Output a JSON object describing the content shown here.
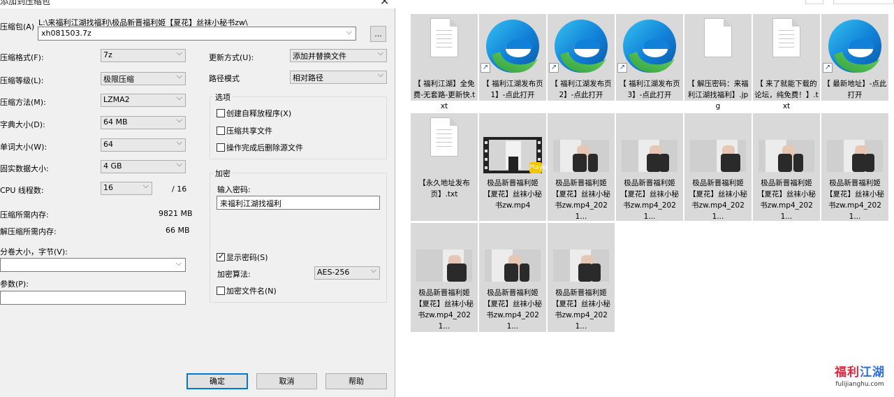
{
  "dialog": {
    "title": "添加到压缩包",
    "archive_label": "压缩包(A)",
    "archive_path": "L:\\来福利江湖找福利\\极品新晋福利姬【夏花】丝袜小秘书zw\\",
    "archive_name": "xh081503.7z",
    "browse_label": "...",
    "format_label": "压缩格式(F):",
    "format_value": "7z",
    "level_label": "压缩等级(L):",
    "level_value": "极限压缩",
    "method_label": "压缩方法(M):",
    "method_value": "LZMA2",
    "dict_label": "字典大小(D):",
    "dict_value": "64 MB",
    "word_label": "单词大小(W):",
    "word_value": "64",
    "solid_label": "固实数据大小:",
    "solid_value": "4 GB",
    "threads_label": "CPU 线程数:",
    "threads_value": "16",
    "threads_total": "/ 16",
    "mem_compress_label": "压缩所需内存:",
    "mem_compress_value": "9821 MB",
    "mem_decompress_label": "解压缩所需内存:",
    "mem_decompress_value": "66 MB",
    "volume_label": "分卷大小，字节(V):",
    "volume_value": "",
    "params_label": "参数(P):",
    "params_value": "",
    "update_label": "更新方式(U):",
    "update_value": "添加并替换文件",
    "pathmode_label": "路径模式",
    "pathmode_value": "相对路径",
    "options_title": "选项",
    "opt_sfx": "创建自释放程序(X)",
    "opt_shared": "压缩共享文件",
    "opt_delete": "操作完成后删除源文件",
    "encrypt_title": "加密",
    "password_label": "输入密码:",
    "password_value": "来福利江湖找福利",
    "show_password": "显示密码(S)",
    "enc_method_label": "加密算法:",
    "enc_method_value": "AES-256",
    "encrypt_names": "加密文件名(N)",
    "ok": "确定",
    "cancel": "取消",
    "help": "帮助"
  },
  "files": [
    {
      "name": "【 福利江湖】全免费-无套路-更新快.txt",
      "kind": "txt"
    },
    {
      "name": "【 福利江湖发布页1】-点此打开",
      "kind": "link"
    },
    {
      "name": "【 福利江湖发布页2】-点此打开",
      "kind": "link"
    },
    {
      "name": "【 福利江湖发布页3】-点此打开",
      "kind": "link"
    },
    {
      "name": "【 解压密码：来福利江湖找福利】.jpg",
      "kind": "doc"
    },
    {
      "name": "【 来了就能下载的论坛，纯免费！】.txt",
      "kind": "txt"
    },
    {
      "name": "【 最新地址】-点此打开",
      "kind": "link"
    },
    {
      "name": "【永久地址发布页】.txt",
      "kind": "txt"
    },
    {
      "name": "极品新晋福利姬【夏花】丝袜小秘书zw.mp4",
      "kind": "video"
    },
    {
      "name": "极品新晋福利姬【夏花】丝袜小秘书zw.mp4_2021...",
      "kind": "image"
    },
    {
      "name": "极品新晋福利姬【夏花】丝袜小秘书zw.mp4_2021...",
      "kind": "image"
    },
    {
      "name": "极品新晋福利姬【夏花】丝袜小秘书zw.mp4_2021...",
      "kind": "image"
    },
    {
      "name": "极品新晋福利姬【夏花】丝袜小秘书zw.mp4_2021...",
      "kind": "image"
    },
    {
      "name": "极品新晋福利姬【夏花】丝袜小秘书zw.mp4_2021...",
      "kind": "image"
    },
    {
      "name": "极品新晋福利姬【夏花】丝袜小秘书zw.mp4_2021...",
      "kind": "image"
    },
    {
      "name": "极品新晋福利姬【夏花】丝袜小秘书zw.mp4_2021...",
      "kind": "image"
    },
    {
      "name": "极品新晋福利姬【夏花】丝袜小秘书zw.mp4_2021...",
      "kind": "image"
    }
  ],
  "badge_text": "Player",
  "watermark": {
    "mark_a": "福利",
    "mark_b": "江湖",
    "url": "fulijianghu.com"
  }
}
